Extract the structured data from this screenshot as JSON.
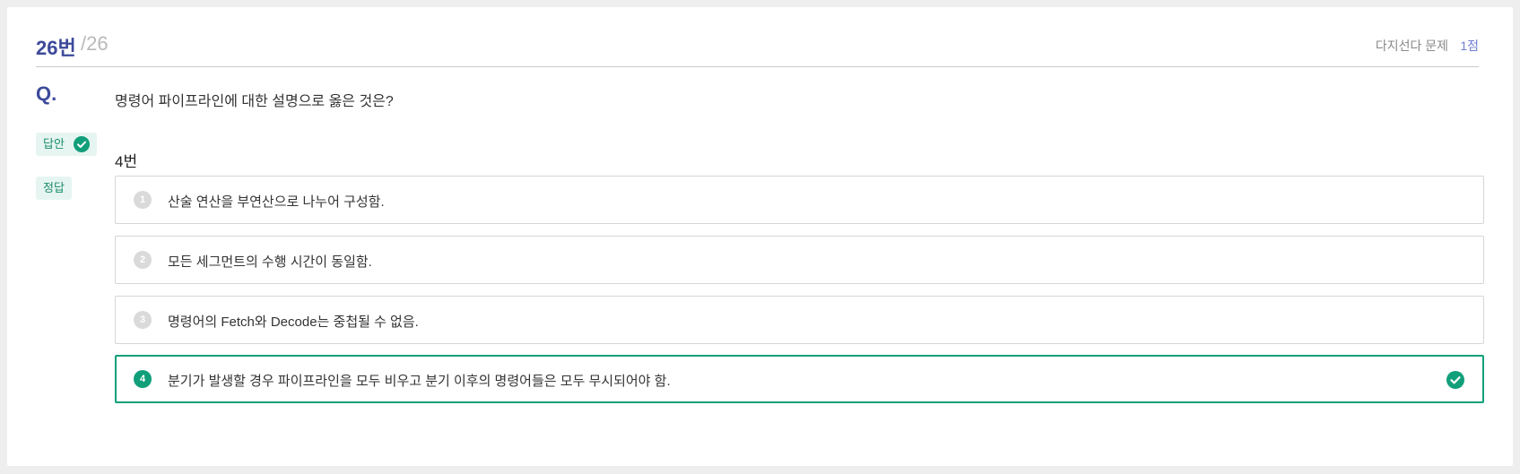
{
  "header": {
    "question_number": "26번",
    "question_total": "/26",
    "question_type": "다지선다 문제",
    "points": "1점"
  },
  "question": {
    "label": "Q.",
    "text": "명령어 파이프라인에 대한 설명으로 옳은 것은?"
  },
  "my_answer": {
    "badge": "답안",
    "value": "4번"
  },
  "correct_answer": {
    "badge": "정답"
  },
  "choices": [
    {
      "num": "1",
      "text": "산술 연산을 부연산으로 나누어 구성함."
    },
    {
      "num": "2",
      "text": "모든 세그먼트의 수행 시간이 동일함."
    },
    {
      "num": "3",
      "text": "명령어의 Fetch와 Decode는 중첩될 수 없음."
    },
    {
      "num": "4",
      "text": "분기가 발생할 경우 파이프라인을 모두 비우고 분기 이후의 명령어들은 모두 무시되어야 함."
    }
  ],
  "colors": {
    "accent_blue": "#3d4a9a",
    "accent_green": "#119f7a",
    "muted": "#b9b9b9"
  }
}
